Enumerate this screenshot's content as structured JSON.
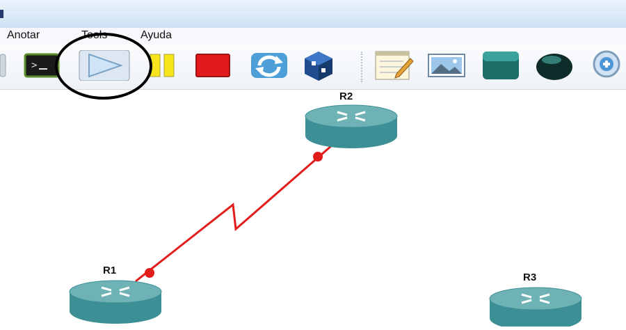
{
  "menu": {
    "items": [
      "Anotar",
      "Tools",
      "Ayuda"
    ]
  },
  "toolbar": {
    "buttons": [
      {
        "name": "console",
        "icon": "terminal-icon"
      },
      {
        "name": "start",
        "icon": "play-icon"
      },
      {
        "name": "suspend",
        "icon": "pause-icon"
      },
      {
        "name": "stop",
        "icon": "stop-icon"
      },
      {
        "name": "reload",
        "icon": "refresh-icon"
      },
      {
        "name": "virtualbox",
        "icon": "virtualbox-icon"
      },
      {
        "name": "add-note",
        "icon": "note-icon"
      },
      {
        "name": "insert-picture",
        "icon": "picture-icon"
      },
      {
        "name": "draw-rectangle",
        "icon": "rectangle-icon"
      },
      {
        "name": "draw-ellipse",
        "icon": "ellipse-icon"
      },
      {
        "name": "zoom-in",
        "icon": "zoom-in-icon"
      }
    ]
  },
  "topology": {
    "routers": [
      {
        "label": "R2"
      },
      {
        "label": "R1"
      },
      {
        "label": "R3"
      }
    ],
    "link": {
      "from": "R1",
      "to": "R2",
      "type": "serial",
      "color": "#e21b1b",
      "status": "up"
    }
  },
  "colors": {
    "router_top": "#6fb2b6",
    "router_body": "#3b8f95",
    "link": "#e21b1b",
    "highlight": "#000000"
  }
}
